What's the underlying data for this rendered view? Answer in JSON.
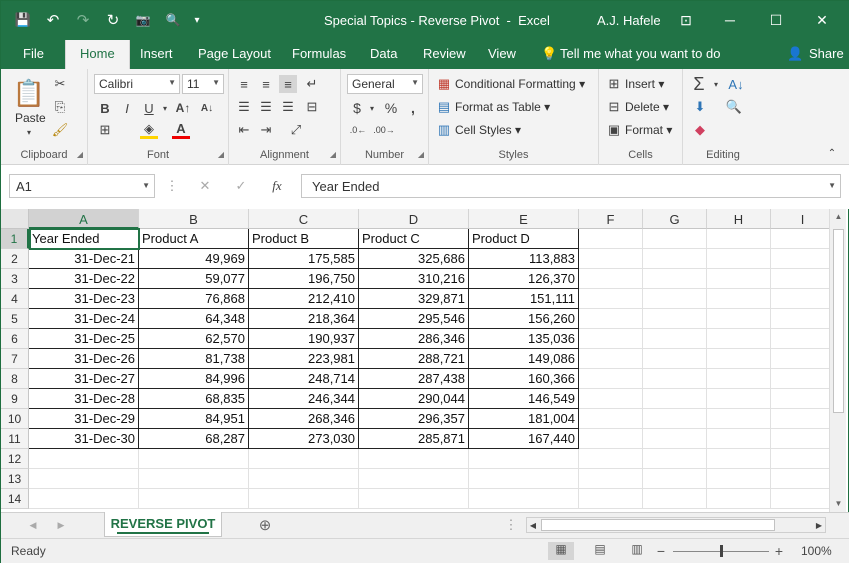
{
  "window": {
    "title": "Special Topics - Reverse Pivot  -  Excel",
    "user": "A.J. Hafele",
    "minimize": "─",
    "maximize": "☐",
    "close": "✕",
    "ribbon_display": "⊡"
  },
  "quick_access": {
    "save": "💾",
    "undo": "↶",
    "undo_dd": "▾",
    "redo": "↷",
    "redo_dd": "▾",
    "refresh": "↻",
    "camera": "📷",
    "preview": "🔍",
    "customize": "▾"
  },
  "tabs": [
    {
      "label": "File"
    },
    {
      "label": "Home"
    },
    {
      "label": "Insert"
    },
    {
      "label": "Page Layout"
    },
    {
      "label": "Formulas"
    },
    {
      "label": "Data"
    },
    {
      "label": "Review"
    },
    {
      "label": "View"
    }
  ],
  "tell_me": "Tell me what you want to do",
  "share": "Share",
  "ribbon": {
    "clipboard": {
      "label": "Clipboard",
      "paste": "Paste"
    },
    "font": {
      "label": "Font",
      "name": "Calibri",
      "size": "11",
      "bold": "B",
      "italic": "I",
      "underline": "U"
    },
    "alignment": {
      "label": "Alignment"
    },
    "number": {
      "label": "Number",
      "format": "General",
      "currency": "$",
      "percent": "%",
      "comma": ","
    },
    "styles": {
      "label": "Styles",
      "conditional": "Conditional Formatting",
      "format_table": "Format as Table",
      "cell_styles": "Cell Styles"
    },
    "cells": {
      "label": "Cells",
      "insert": "Insert",
      "delete": "Delete",
      "format": "Format"
    },
    "editing": {
      "label": "Editing",
      "sum": "Σ"
    }
  },
  "formula_bar": {
    "name_box": "A1",
    "fx": "fx",
    "value": "Year Ended"
  },
  "columns": [
    "A",
    "B",
    "C",
    "D",
    "E",
    "F",
    "G",
    "H",
    "I"
  ],
  "rows": [
    "1",
    "2",
    "3",
    "4",
    "5",
    "6",
    "7",
    "8",
    "9",
    "10",
    "11",
    "12",
    "13",
    "14"
  ],
  "table": {
    "headers": [
      "Year Ended",
      "Product A",
      "Product B",
      "Product C",
      "Product D"
    ],
    "data": [
      [
        "31-Dec-21",
        "49,969",
        "175,585",
        "325,686",
        "113,883"
      ],
      [
        "31-Dec-22",
        "59,077",
        "196,750",
        "310,216",
        "126,370"
      ],
      [
        "31-Dec-23",
        "76,868",
        "212,410",
        "329,871",
        "151,111"
      ],
      [
        "31-Dec-24",
        "64,348",
        "218,364",
        "295,546",
        "156,260"
      ],
      [
        "31-Dec-25",
        "62,570",
        "190,937",
        "286,346",
        "135,036"
      ],
      [
        "31-Dec-26",
        "81,738",
        "223,981",
        "288,721",
        "149,086"
      ],
      [
        "31-Dec-27",
        "84,996",
        "248,714",
        "287,438",
        "160,366"
      ],
      [
        "31-Dec-28",
        "68,835",
        "246,344",
        "290,044",
        "146,549"
      ],
      [
        "31-Dec-29",
        "84,951",
        "268,346",
        "296,357",
        "181,004"
      ],
      [
        "31-Dec-30",
        "68,287",
        "273,030",
        "285,871",
        "167,440"
      ]
    ]
  },
  "sheet_tab": "REVERSE PIVOT",
  "status": "Ready",
  "zoom": "100%"
}
